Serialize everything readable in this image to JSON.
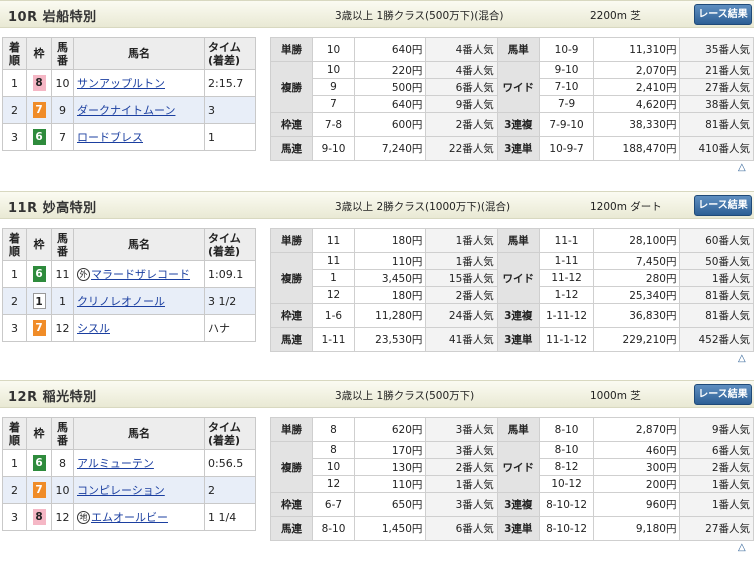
{
  "colors": {
    "w1": "#ffffff",
    "w2": "#333333",
    "w3": "#e64545",
    "w4": "#3b6fd6",
    "w5": "#e8d54a",
    "w6": "#2e8b3c",
    "w7": "#f08c28",
    "w8": "#f5b7c5"
  },
  "header_labels": {
    "rank": "着順",
    "waku": "枠",
    "num": "馬番",
    "name": "馬名",
    "time": "タイム(着差)"
  },
  "result_button": "レース結果",
  "triangle": "△",
  "races": [
    {
      "title": "10R 岩船特別",
      "cond": "3歳以上 1勝クラス(500万下)(混合)",
      "dist": "2200m 芝",
      "finishers": [
        {
          "rank": "1",
          "waku": "8",
          "num": "10",
          "mark": "",
          "name": "サンアップルトン",
          "time": "2:15.7"
        },
        {
          "rank": "2",
          "waku": "7",
          "num": "9",
          "mark": "",
          "name": "ダークナイトムーン",
          "time": "3"
        },
        {
          "rank": "3",
          "waku": "6",
          "num": "7",
          "mark": "",
          "name": "ロードブレス",
          "time": "1"
        }
      ],
      "payouts": {
        "tansho": {
          "label": "単勝",
          "rows": [
            {
              "c": "10",
              "y": "640円",
              "p": "4番人気"
            }
          ]
        },
        "fukusho": {
          "label": "複勝",
          "rows": [
            {
              "c": "10",
              "y": "220円",
              "p": "4番人気"
            },
            {
              "c": "9",
              "y": "500円",
              "p": "6番人気"
            },
            {
              "c": "7",
              "y": "640円",
              "p": "9番人気"
            }
          ]
        },
        "wakuren": {
          "label": "枠連",
          "rows": [
            {
              "c": "7-8",
              "y": "600円",
              "p": "2番人気"
            }
          ]
        },
        "umaren": {
          "label": "馬連",
          "rows": [
            {
              "c": "9-10",
              "y": "7,240円",
              "p": "22番人気"
            }
          ]
        },
        "umatan": {
          "label": "馬単",
          "rows": [
            {
              "c": "10-9",
              "y": "11,310円",
              "p": "35番人気"
            }
          ]
        },
        "wide": {
          "label": "ワイド",
          "rows": [
            {
              "c": "9-10",
              "y": "2,070円",
              "p": "21番人気"
            },
            {
              "c": "7-10",
              "y": "2,410円",
              "p": "27番人気"
            },
            {
              "c": "7-9",
              "y": "4,620円",
              "p": "38番人気"
            }
          ]
        },
        "sanrenpuku": {
          "label": "3連複",
          "rows": [
            {
              "c": "7-9-10",
              "y": "38,330円",
              "p": "81番人気"
            }
          ]
        },
        "sanrentan": {
          "label": "3連単",
          "rows": [
            {
              "c": "10-9-7",
              "y": "188,470円",
              "p": "410番人気"
            }
          ]
        }
      }
    },
    {
      "title": "11R 妙高特別",
      "cond": "3歳以上 2勝クラス(1000万下)(混合)",
      "dist": "1200m ダート",
      "finishers": [
        {
          "rank": "1",
          "waku": "6",
          "num": "11",
          "mark": "外",
          "name": "マラードザレコード",
          "time": "1:09.1"
        },
        {
          "rank": "2",
          "waku": "1",
          "num": "1",
          "mark": "",
          "name": "クリノレオノール",
          "time": "3 1/2"
        },
        {
          "rank": "3",
          "waku": "7",
          "num": "12",
          "mark": "",
          "name": "シスル",
          "time": "ハナ"
        }
      ],
      "payouts": {
        "tansho": {
          "label": "単勝",
          "rows": [
            {
              "c": "11",
              "y": "180円",
              "p": "1番人気"
            }
          ]
        },
        "fukusho": {
          "label": "複勝",
          "rows": [
            {
              "c": "11",
              "y": "110円",
              "p": "1番人気"
            },
            {
              "c": "1",
              "y": "3,450円",
              "p": "15番人気"
            },
            {
              "c": "12",
              "y": "180円",
              "p": "2番人気"
            }
          ]
        },
        "wakuren": {
          "label": "枠連",
          "rows": [
            {
              "c": "1-6",
              "y": "11,280円",
              "p": "24番人気"
            }
          ]
        },
        "umaren": {
          "label": "馬連",
          "rows": [
            {
              "c": "1-11",
              "y": "23,530円",
              "p": "41番人気"
            }
          ]
        },
        "umatan": {
          "label": "馬単",
          "rows": [
            {
              "c": "11-1",
              "y": "28,100円",
              "p": "60番人気"
            }
          ]
        },
        "wide": {
          "label": "ワイド",
          "rows": [
            {
              "c": "1-11",
              "y": "7,450円",
              "p": "50番人気"
            },
            {
              "c": "11-12",
              "y": "280円",
              "p": "1番人気"
            },
            {
              "c": "1-12",
              "y": "25,340円",
              "p": "81番人気"
            }
          ]
        },
        "sanrenpuku": {
          "label": "3連複",
          "rows": [
            {
              "c": "1-11-12",
              "y": "36,830円",
              "p": "81番人気"
            }
          ]
        },
        "sanrentan": {
          "label": "3連単",
          "rows": [
            {
              "c": "11-1-12",
              "y": "229,210円",
              "p": "452番人気"
            }
          ]
        }
      }
    },
    {
      "title": "12R 稲光特別",
      "cond": "3歳以上 1勝クラス(500万下)",
      "dist": "1000m 芝",
      "finishers": [
        {
          "rank": "1",
          "waku": "6",
          "num": "8",
          "mark": "",
          "name": "アルミューテン",
          "time": "0:56.5"
        },
        {
          "rank": "2",
          "waku": "7",
          "num": "10",
          "mark": "",
          "name": "コンピレーション",
          "time": "2"
        },
        {
          "rank": "3",
          "waku": "8",
          "num": "12",
          "mark": "地",
          "name": "エムオールビー",
          "time": "1 1/4"
        }
      ],
      "payouts": {
        "tansho": {
          "label": "単勝",
          "rows": [
            {
              "c": "8",
              "y": "620円",
              "p": "3番人気"
            }
          ]
        },
        "fukusho": {
          "label": "複勝",
          "rows": [
            {
              "c": "8",
              "y": "170円",
              "p": "3番人気"
            },
            {
              "c": "10",
              "y": "130円",
              "p": "2番人気"
            },
            {
              "c": "12",
              "y": "110円",
              "p": "1番人気"
            }
          ]
        },
        "wakuren": {
          "label": "枠連",
          "rows": [
            {
              "c": "6-7",
              "y": "650円",
              "p": "3番人気"
            }
          ]
        },
        "umaren": {
          "label": "馬連",
          "rows": [
            {
              "c": "8-10",
              "y": "1,450円",
              "p": "6番人気"
            }
          ]
        },
        "umatan": {
          "label": "馬単",
          "rows": [
            {
              "c": "8-10",
              "y": "2,870円",
              "p": "9番人気"
            }
          ]
        },
        "wide": {
          "label": "ワイド",
          "rows": [
            {
              "c": "8-10",
              "y": "460円",
              "p": "6番人気"
            },
            {
              "c": "8-12",
              "y": "300円",
              "p": "2番人気"
            },
            {
              "c": "10-12",
              "y": "200円",
              "p": "1番人気"
            }
          ]
        },
        "sanrenpuku": {
          "label": "3連複",
          "rows": [
            {
              "c": "8-10-12",
              "y": "960円",
              "p": "1番人気"
            }
          ]
        },
        "sanrentan": {
          "label": "3連単",
          "rows": [
            {
              "c": "8-10-12",
              "y": "9,180円",
              "p": "27番人気"
            }
          ]
        }
      }
    }
  ]
}
